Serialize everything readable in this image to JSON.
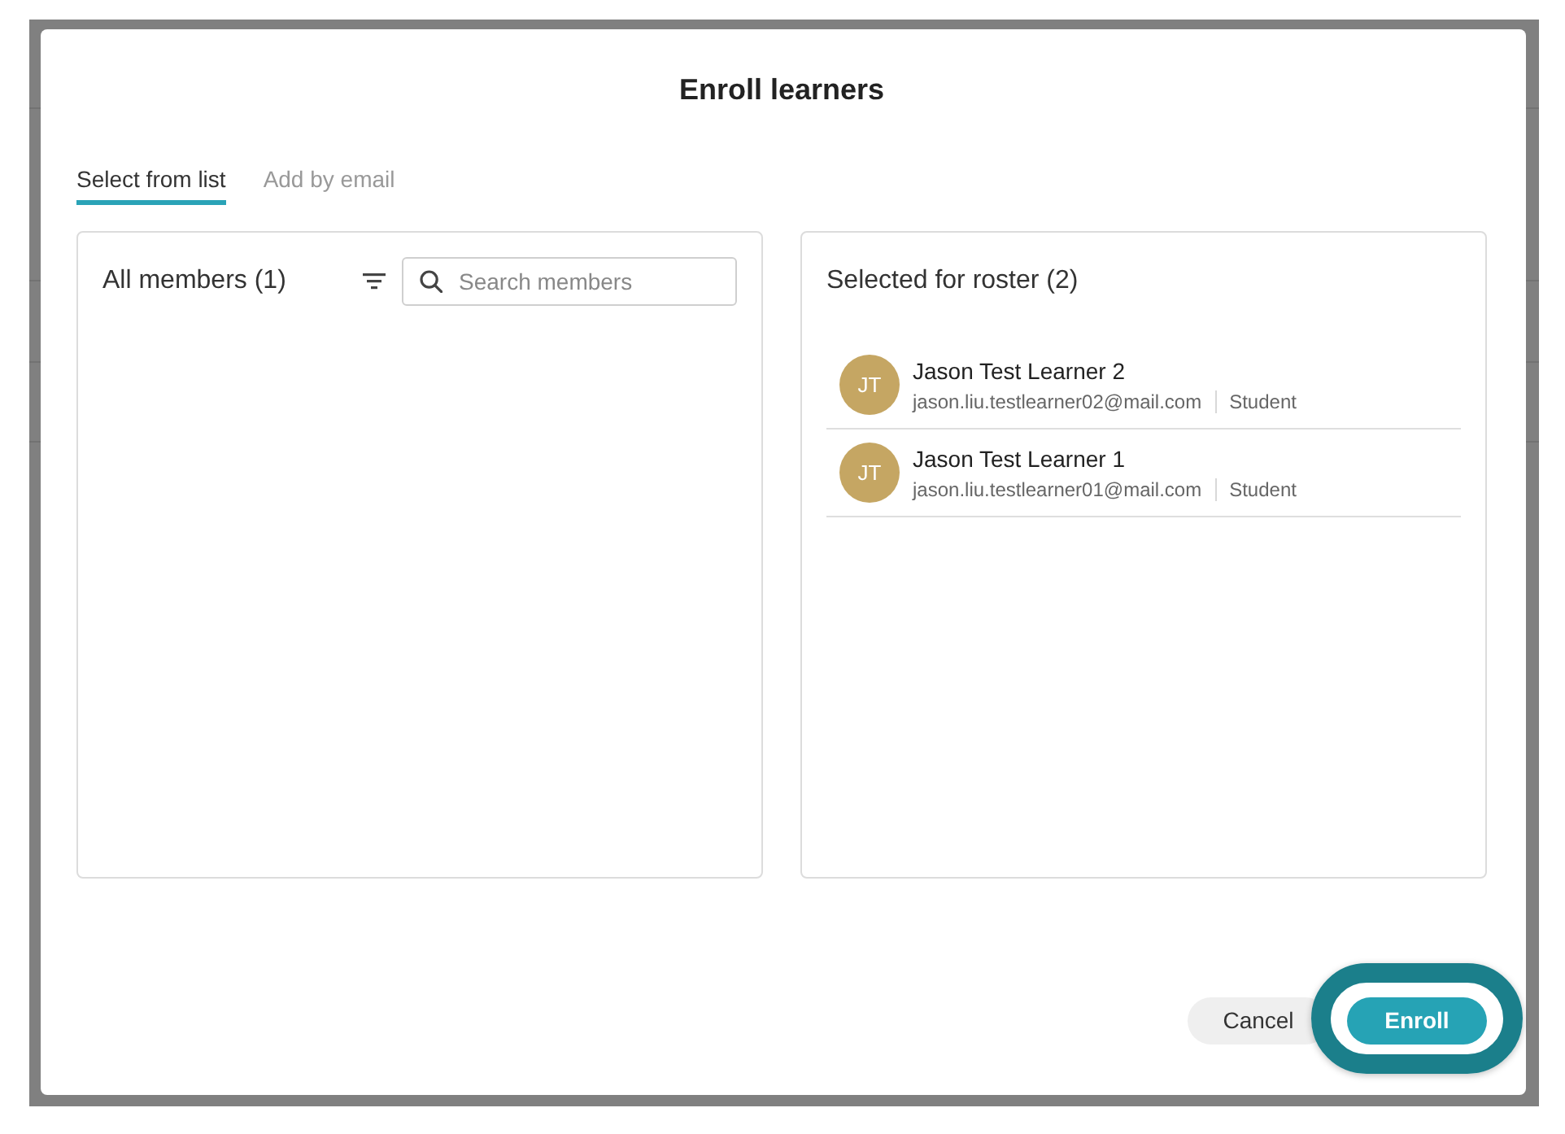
{
  "dialog": {
    "title": "Enroll learners"
  },
  "tabs": [
    {
      "label": "Select from list",
      "selected": true
    },
    {
      "label": "Add by email",
      "selected": false
    }
  ],
  "members_panel": {
    "title": "All members (1)",
    "search": {
      "placeholder": "Search members"
    }
  },
  "roster_panel": {
    "title": "Selected for roster (2)",
    "learners": [
      {
        "initials": "JT",
        "name": "Jason Test Learner 2",
        "email": "jason.liu.testlearner02@mail.com",
        "role": "Student"
      },
      {
        "initials": "JT",
        "name": "Jason Test Learner 1",
        "email": "jason.liu.testlearner01@mail.com",
        "role": "Student"
      }
    ]
  },
  "buttons": [
    {
      "label": "Cancel",
      "kind": "secondary",
      "highlighted": false
    },
    {
      "label": "Enroll",
      "kind": "primary",
      "highlighted": true
    }
  ]
}
